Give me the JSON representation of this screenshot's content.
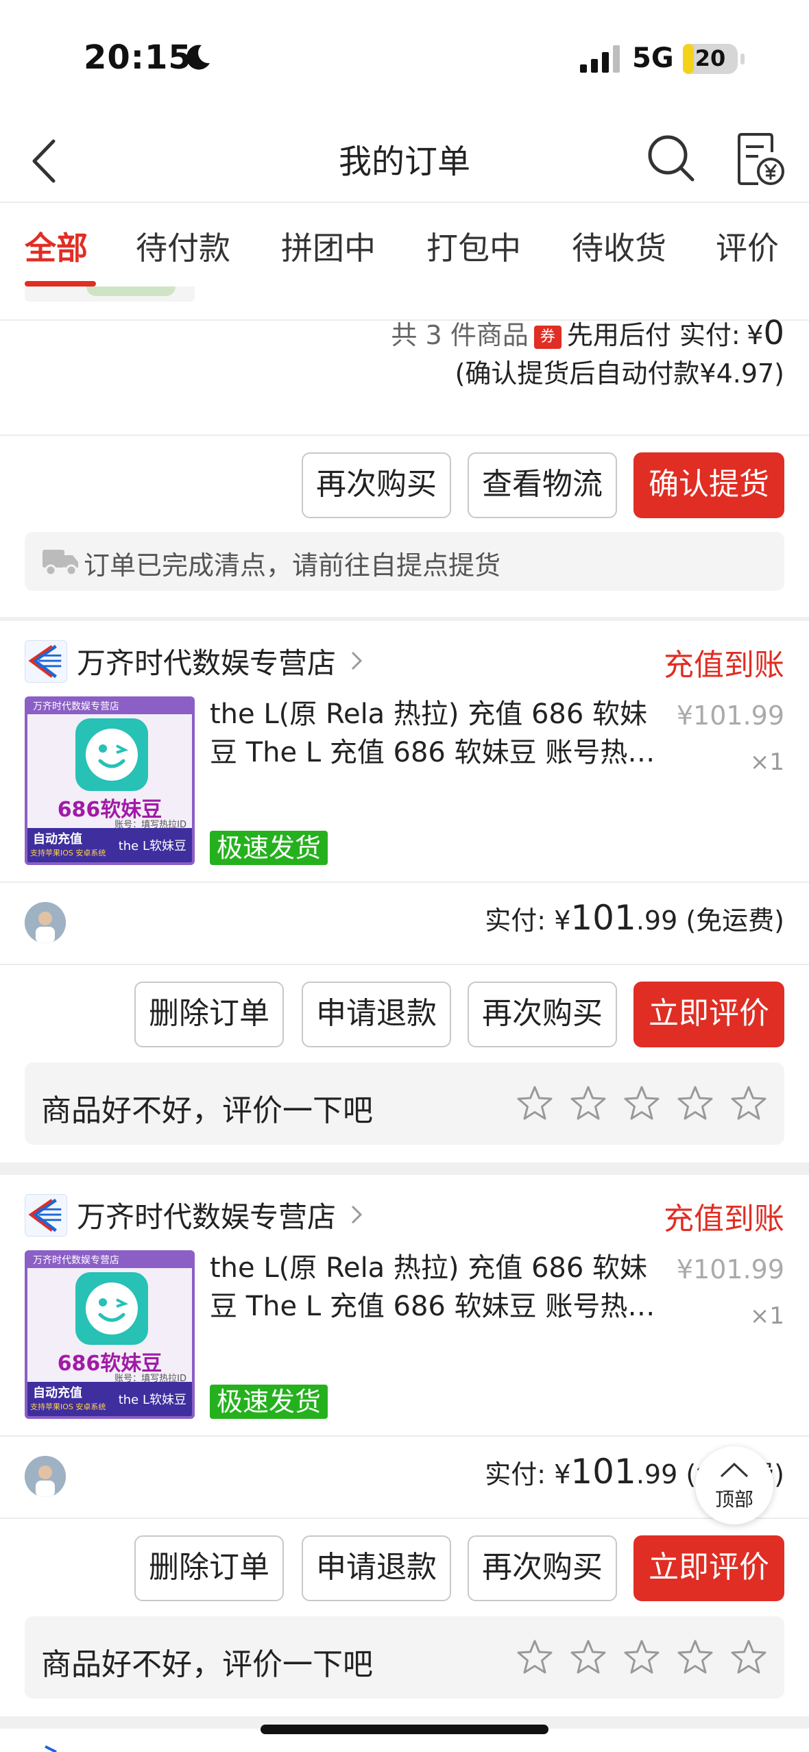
{
  "status_bar": {
    "time": "20:15",
    "network": "5G",
    "battery": "20",
    "battery_level": 0.2
  },
  "header": {
    "title": "我的订单",
    "back_icon": "chevron-left-icon",
    "search_icon": "search-icon",
    "bill_icon": "bill-yen-icon"
  },
  "tabs": [
    {
      "label": "全部",
      "active": true
    },
    {
      "label": "待付款"
    },
    {
      "label": "拼团中"
    },
    {
      "label": "打包中"
    },
    {
      "label": "待收货"
    },
    {
      "label": "评价"
    }
  ],
  "order1": {
    "summary_prefix": "共",
    "summary_count": "3",
    "summary_suffix": "件商品",
    "coupon_text": "券",
    "pay_label": "先用后付 实付:",
    "currency": "¥",
    "amount": "0",
    "auto_pay_note": "(确认提货后自动付款¥4.97)",
    "buttons": [
      "再次购买",
      "查看物流",
      "确认提货"
    ],
    "notice": "订单已完成清点，请前往自提点提货"
  },
  "order2": {
    "store_name": "万齐时代数娱专营店",
    "status": "充值到账",
    "product_title": "the L(原 Rela 热拉) 充值 686 软妹豆 The L 充值 686 软妹豆 账号热…",
    "price": "¥101.99",
    "qty": "×1",
    "tag": "极速发货",
    "thumb": {
      "top": "万齐时代数娱专营店",
      "title": "686软妹豆",
      "sub": "账号：填写热拉ID",
      "left": "自动充值",
      "left2": "支持苹果IOS 安卓系统",
      "right": "the L软妹豆"
    },
    "paid_label": "实付:",
    "currency": "¥",
    "paid_amount": "101",
    "paid_decimal": ".99",
    "shipping": "(免运费)",
    "buttons": [
      "删除订单",
      "申请退款",
      "再次购买",
      "立即评价"
    ],
    "review_prompt": "商品好不好，评价一下吧",
    "stars": 5
  },
  "order3": {
    "store_name": "万齐时代数娱专营店",
    "status": "充值到账",
    "product_title": "the L(原 Rela 热拉) 充值 686 软妹豆 The L 充值 686 软妹豆 账号热…",
    "price": "¥101.99",
    "qty": "×1",
    "tag": "极速发货",
    "thumb": {
      "top": "万齐时代数娱专营店",
      "title": "686软妹豆",
      "sub": "账号：填写热拉ID",
      "left": "自动充值",
      "left2": "支持苹果IOS 安卓系统",
      "right": "the L软妹豆"
    },
    "paid_label": "实付:",
    "currency": "¥",
    "paid_amount": "101",
    "paid_decimal": ".99",
    "shipping": "(免运费)",
    "buttons": [
      "删除订单",
      "申请退款",
      "再次购买",
      "立即评价"
    ],
    "review_prompt": "商品好不好，评价一下吧",
    "stars": 5
  },
  "back_to_top": {
    "label": "顶部",
    "icon": "chevron-up-icon"
  },
  "colors": {
    "accent": "#e02e24",
    "tag_green": "#25b11e",
    "battery": "#f4d21a"
  }
}
